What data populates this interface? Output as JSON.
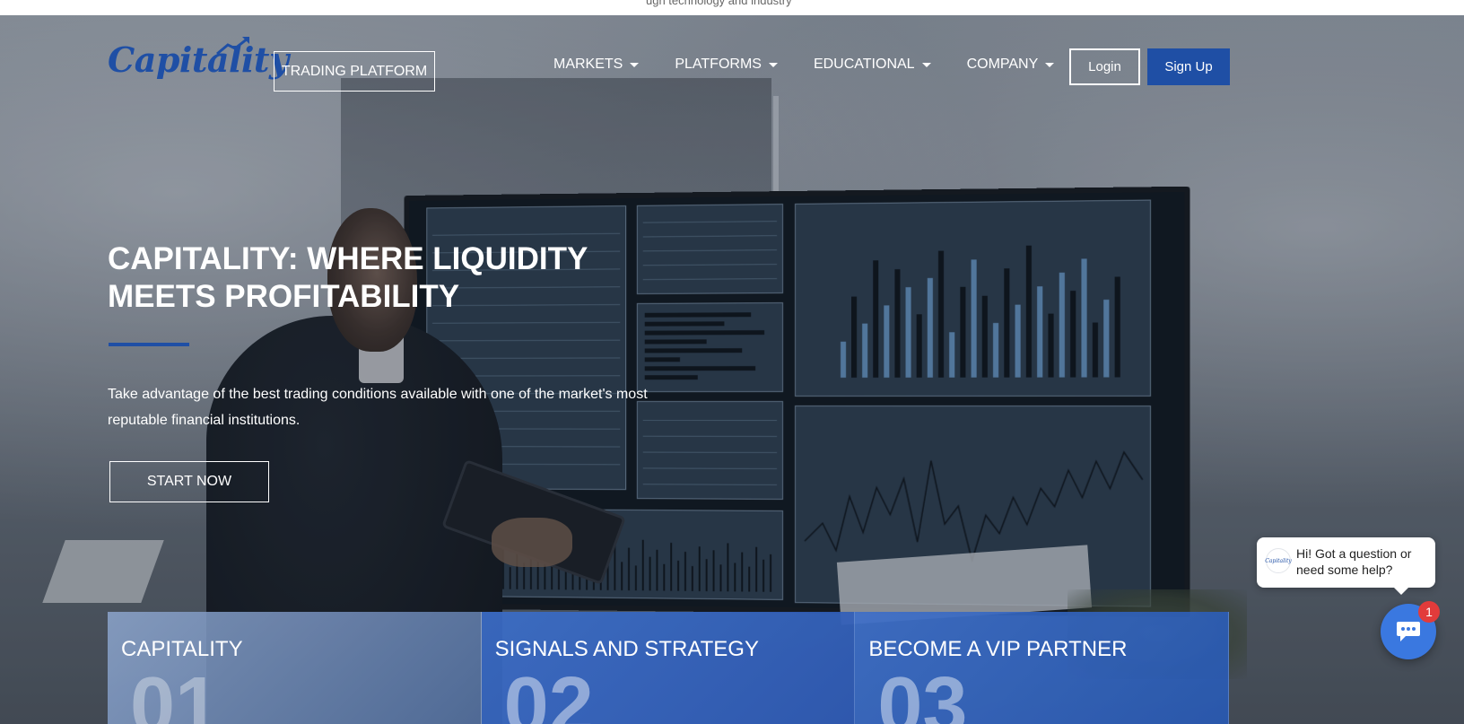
{
  "top_strip": {
    "text": "ugh technology and industry"
  },
  "brand": {
    "logo_text": "Capitality",
    "accent_color": "#1f4fa5"
  },
  "navbar": {
    "trading_platform_label": "TRADING PLATFORM",
    "menu": [
      {
        "label": "MARKETS",
        "has_dropdown": true
      },
      {
        "label": "PLATFORMS",
        "has_dropdown": true
      },
      {
        "label": "EDUCATIONAL",
        "has_dropdown": true
      },
      {
        "label": "COMPANY",
        "has_dropdown": true
      }
    ],
    "login_label": "Login",
    "signup_label": "Sign Up"
  },
  "hero": {
    "title_line1": "CAPITALITY: WHERE LIQUIDITY",
    "title_line2": "MEETS PROFITABILITY",
    "description_line1": "Take advantage of the best trading conditions available with one of the market's most",
    "description_line2": "reputable financial institutions.",
    "cta_label": "START NOW"
  },
  "cards": [
    {
      "title": "CAPITALITY",
      "number": "01"
    },
    {
      "title": "SIGNALS AND STRATEGY",
      "number": "02"
    },
    {
      "title": "BECOME A VIP PARTNER",
      "number": "03"
    }
  ],
  "chat": {
    "greeting": "Hi! Got a question or need some help?",
    "avatar_text": "Capitality",
    "badge_count": "1",
    "launcher_color": "#3a78e0",
    "badge_color": "#e23b3b"
  }
}
